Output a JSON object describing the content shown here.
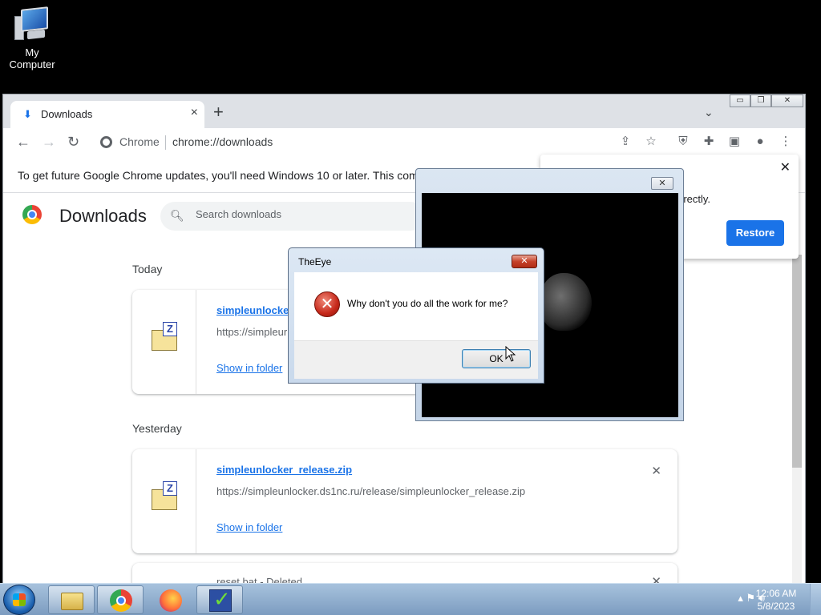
{
  "desktop": {
    "icons": [
      {
        "label": "My Computer",
        "icon": "computer-icon"
      }
    ]
  },
  "chrome": {
    "tab": {
      "title": "Downloads",
      "icon": "download-icon"
    },
    "newtab_label": "+",
    "window_controls": {
      "minimize": "▭",
      "restore": "❐",
      "close": "✕"
    },
    "omnibox": {
      "label": "Chrome",
      "url": "chrome://downloads"
    },
    "infobar_text": "To get future Google Chrome updates, you'll need Windows 10 or later. This computer",
    "restore_bubble": {
      "text_fragment": "rrectly.",
      "button": "Restore"
    },
    "downloads": {
      "title": "Downloads",
      "search_placeholder": "Search downloads",
      "sections": [
        {
          "label": "Today",
          "items": [
            {
              "name": "simpleunlocker_",
              "url": "https://simpleur",
              "action": "Show in folder"
            }
          ]
        },
        {
          "label": "Yesterday",
          "items": [
            {
              "name": "simpleunlocker_release.zip",
              "url": "https://simpleunlocker.ds1nc.ru/release/simpleunlocker_release.zip",
              "action": "Show in folder"
            }
          ]
        }
      ],
      "partial_item": "reset.bat - Deleted"
    }
  },
  "eye_window": {
    "title": ""
  },
  "dialog": {
    "title": "TheEye",
    "message": "Why don't you do all the work for me?",
    "ok": "OK"
  },
  "taskbar": {
    "apps": [
      "Windows Explorer",
      "Google Chrome",
      "Firefox",
      "TheEye"
    ],
    "clock": {
      "time": "12:06 AM",
      "date": "5/8/2023"
    }
  },
  "colors": {
    "accent": "#1a73e8",
    "desktop_bg": "#000000",
    "taskbar": "#8fb0d1"
  }
}
